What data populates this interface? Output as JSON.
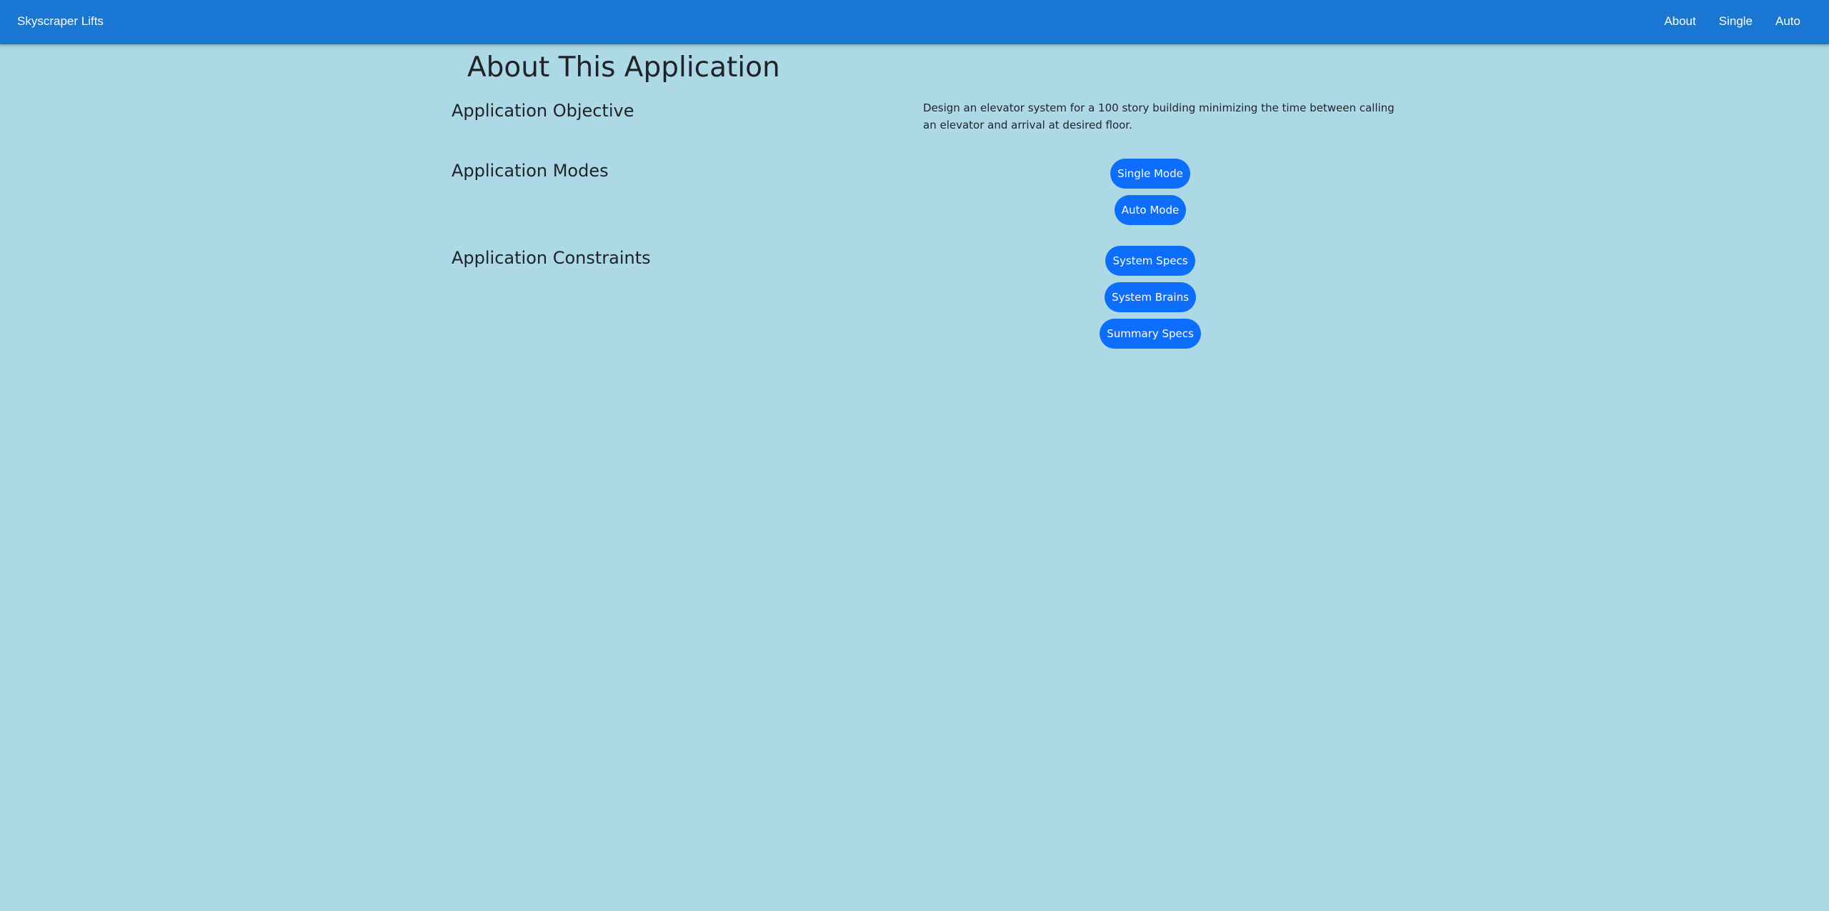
{
  "navbar": {
    "brand": "Skyscraper Lifts",
    "links": [
      "About",
      "Single",
      "Auto"
    ]
  },
  "page": {
    "title": "About This Application"
  },
  "sections": {
    "objective": {
      "title": "Application Objective",
      "text": "Design an elevator system for a 100 story building minimizing the time between calling an elevator and arrival at desired floor."
    },
    "modes": {
      "title": "Application Modes",
      "buttons": [
        "Single Mode",
        "Auto Mode"
      ]
    },
    "constraints": {
      "title": "Application Constraints",
      "buttons": [
        "System Specs",
        "System Brains",
        "Summary Specs"
      ]
    }
  },
  "colors": {
    "navbar": "#1976d2",
    "background": "#add8e6",
    "button": "#0d6efd"
  }
}
